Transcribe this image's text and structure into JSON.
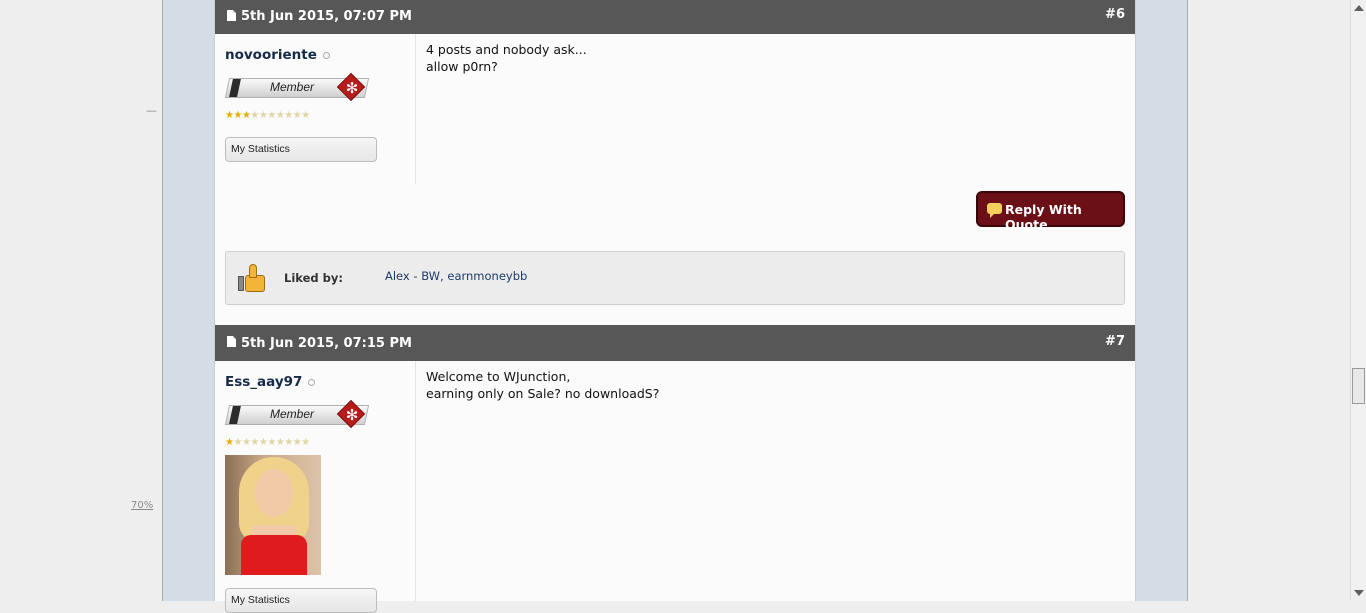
{
  "sidebar": {
    "dash": "—",
    "zoom": "70%"
  },
  "posts": [
    {
      "date": "5th Jun 2015, 07:07 PM",
      "number": "#6",
      "username": "novooriente",
      "rank": "Member",
      "stars_on": 3,
      "stars_total": 10,
      "stats_label": "My Statistics",
      "message": "4 posts and nobody ask...\nallow p0rn?",
      "reply_label": "Reply With Quote",
      "liked_label": "Liked by:",
      "liked_users": [
        "Alex - BW",
        "earnmoneybb"
      ]
    },
    {
      "date": "5th Jun 2015, 07:15 PM",
      "number": "#7",
      "username": "Ess_aay97",
      "rank": "Member",
      "stars_on": 1,
      "stars_total": 10,
      "stats_label": "My Statistics",
      "message": "Welcome to WJunction,\nearning only on Sale? no downloadS?"
    }
  ],
  "colors": {
    "header": "#575757",
    "reply_button": "#6b1016",
    "username": "#152b49",
    "frame": "#d4dde6"
  }
}
